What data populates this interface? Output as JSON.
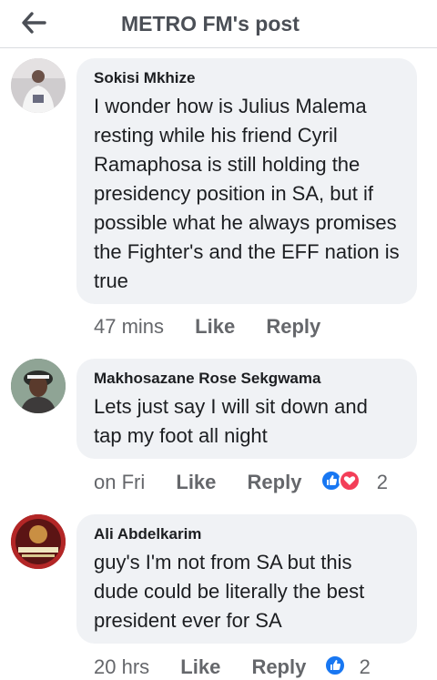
{
  "header": {
    "title": "METRO FM's post",
    "back_icon": "arrow-left-icon"
  },
  "colors": {
    "like_blue": "#1877f2",
    "love_red": "#f33e58",
    "bubble_bg": "#f0f2f5",
    "meta_gray": "#65676b"
  },
  "comments": [
    {
      "author": "Sokisi Mkhize",
      "text": "I wonder how is Julius Malema resting while his friend Cyril Ramaphosa is still holding the presidency position in SA, but if possible what he always promises the Fighter's and the EFF nation is true",
      "time": "47 mins",
      "like_label": "Like",
      "reply_label": "Reply"
    },
    {
      "author": "Makhosazane Rose Sekgwama",
      "text": "Lets just say I will sit down and tap my foot all night",
      "time": "on Fri",
      "like_label": "Like",
      "reply_label": "Reply",
      "reactions": [
        "like",
        "love"
      ],
      "reaction_count": "2"
    },
    {
      "author": "Ali Abdelkarim",
      "text": "guy's I'm not from SA but this dude  could be literally the best president ever for SA",
      "time": "20 hrs",
      "like_label": "Like",
      "reply_label": "Reply",
      "reactions": [
        "like"
      ],
      "reaction_count": "2"
    }
  ]
}
